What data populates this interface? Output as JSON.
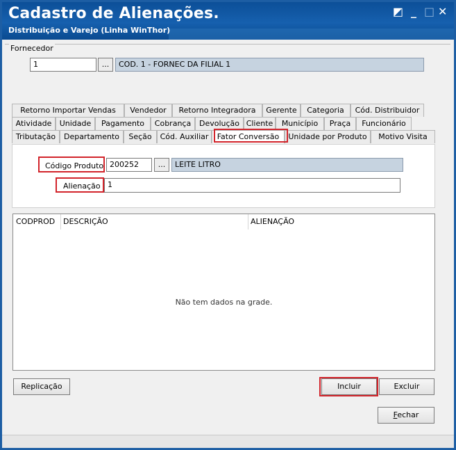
{
  "window": {
    "title": "Cadastro de Alienações.",
    "subtitle": "Distribuição e Varejo (Linha WinThor)",
    "controls": [
      "◩",
      "_",
      "□",
      "✕"
    ]
  },
  "fornecedor": {
    "group_label": "Fornecedor",
    "code": "1",
    "lookup_button": "...",
    "description": "COD. 1 - FORNEC DA FILIAL 1"
  },
  "tabs": {
    "row1": [
      "Retorno Importar Vendas",
      "Vendedor",
      "Retorno Integradora",
      "Gerente",
      "Categoria",
      "Cód. Distribuidor"
    ],
    "row2": [
      "Atividade",
      "Unidade",
      "Pagamento",
      "Cobrança",
      "Devolução",
      "Cliente",
      "Município",
      "Praça",
      "Funcionário"
    ],
    "row3": [
      "Tributação",
      "Departamento",
      "Seção",
      "Cód. Auxiliar",
      "Fator Conversão",
      "Unidade por Produto",
      "Motivo Visita"
    ],
    "active": "Fator Conversão"
  },
  "form": {
    "codigo_label": "Código Produto",
    "codigo_value": "200252",
    "lookup_button": "...",
    "produto_desc": "LEITE LITRO",
    "alienacao_label": "Alienação",
    "alienacao_value": "1"
  },
  "grid": {
    "columns": [
      "CODPROD",
      "DESCRIÇÃO",
      "ALIENAÇÃO"
    ],
    "empty_text": "Não tem dados na grade."
  },
  "buttons": {
    "replicacao": "Replicação",
    "incluir": "Incluir",
    "excluir": "Excluir",
    "fechar_first": "F",
    "fechar_rest": "echar"
  },
  "colors": {
    "titlebar": "#1660ae",
    "highlight": "#d2232a",
    "readonly_field": "#c6d3e0"
  }
}
